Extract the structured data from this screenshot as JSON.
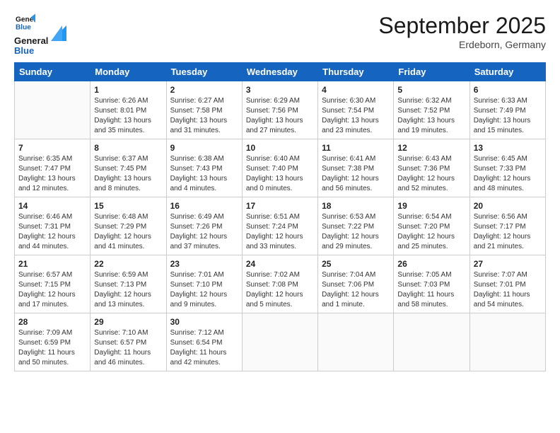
{
  "header": {
    "logo_line1": "General",
    "logo_line2": "Blue",
    "month_title": "September 2025",
    "subtitle": "Erdeborn, Germany"
  },
  "weekdays": [
    "Sunday",
    "Monday",
    "Tuesday",
    "Wednesday",
    "Thursday",
    "Friday",
    "Saturday"
  ],
  "weeks": [
    [
      {
        "day": "",
        "info": ""
      },
      {
        "day": "1",
        "info": "Sunrise: 6:26 AM\nSunset: 8:01 PM\nDaylight: 13 hours\nand 35 minutes."
      },
      {
        "day": "2",
        "info": "Sunrise: 6:27 AM\nSunset: 7:58 PM\nDaylight: 13 hours\nand 31 minutes."
      },
      {
        "day": "3",
        "info": "Sunrise: 6:29 AM\nSunset: 7:56 PM\nDaylight: 13 hours\nand 27 minutes."
      },
      {
        "day": "4",
        "info": "Sunrise: 6:30 AM\nSunset: 7:54 PM\nDaylight: 13 hours\nand 23 minutes."
      },
      {
        "day": "5",
        "info": "Sunrise: 6:32 AM\nSunset: 7:52 PM\nDaylight: 13 hours\nand 19 minutes."
      },
      {
        "day": "6",
        "info": "Sunrise: 6:33 AM\nSunset: 7:49 PM\nDaylight: 13 hours\nand 15 minutes."
      }
    ],
    [
      {
        "day": "7",
        "info": "Sunrise: 6:35 AM\nSunset: 7:47 PM\nDaylight: 13 hours\nand 12 minutes."
      },
      {
        "day": "8",
        "info": "Sunrise: 6:37 AM\nSunset: 7:45 PM\nDaylight: 13 hours\nand 8 minutes."
      },
      {
        "day": "9",
        "info": "Sunrise: 6:38 AM\nSunset: 7:43 PM\nDaylight: 13 hours\nand 4 minutes."
      },
      {
        "day": "10",
        "info": "Sunrise: 6:40 AM\nSunset: 7:40 PM\nDaylight: 13 hours\nand 0 minutes."
      },
      {
        "day": "11",
        "info": "Sunrise: 6:41 AM\nSunset: 7:38 PM\nDaylight: 12 hours\nand 56 minutes."
      },
      {
        "day": "12",
        "info": "Sunrise: 6:43 AM\nSunset: 7:36 PM\nDaylight: 12 hours\nand 52 minutes."
      },
      {
        "day": "13",
        "info": "Sunrise: 6:45 AM\nSunset: 7:33 PM\nDaylight: 12 hours\nand 48 minutes."
      }
    ],
    [
      {
        "day": "14",
        "info": "Sunrise: 6:46 AM\nSunset: 7:31 PM\nDaylight: 12 hours\nand 44 minutes."
      },
      {
        "day": "15",
        "info": "Sunrise: 6:48 AM\nSunset: 7:29 PM\nDaylight: 12 hours\nand 41 minutes."
      },
      {
        "day": "16",
        "info": "Sunrise: 6:49 AM\nSunset: 7:26 PM\nDaylight: 12 hours\nand 37 minutes."
      },
      {
        "day": "17",
        "info": "Sunrise: 6:51 AM\nSunset: 7:24 PM\nDaylight: 12 hours\nand 33 minutes."
      },
      {
        "day": "18",
        "info": "Sunrise: 6:53 AM\nSunset: 7:22 PM\nDaylight: 12 hours\nand 29 minutes."
      },
      {
        "day": "19",
        "info": "Sunrise: 6:54 AM\nSunset: 7:20 PM\nDaylight: 12 hours\nand 25 minutes."
      },
      {
        "day": "20",
        "info": "Sunrise: 6:56 AM\nSunset: 7:17 PM\nDaylight: 12 hours\nand 21 minutes."
      }
    ],
    [
      {
        "day": "21",
        "info": "Sunrise: 6:57 AM\nSunset: 7:15 PM\nDaylight: 12 hours\nand 17 minutes."
      },
      {
        "day": "22",
        "info": "Sunrise: 6:59 AM\nSunset: 7:13 PM\nDaylight: 12 hours\nand 13 minutes."
      },
      {
        "day": "23",
        "info": "Sunrise: 7:01 AM\nSunset: 7:10 PM\nDaylight: 12 hours\nand 9 minutes."
      },
      {
        "day": "24",
        "info": "Sunrise: 7:02 AM\nSunset: 7:08 PM\nDaylight: 12 hours\nand 5 minutes."
      },
      {
        "day": "25",
        "info": "Sunrise: 7:04 AM\nSunset: 7:06 PM\nDaylight: 12 hours\nand 1 minute."
      },
      {
        "day": "26",
        "info": "Sunrise: 7:05 AM\nSunset: 7:03 PM\nDaylight: 11 hours\nand 58 minutes."
      },
      {
        "day": "27",
        "info": "Sunrise: 7:07 AM\nSunset: 7:01 PM\nDaylight: 11 hours\nand 54 minutes."
      }
    ],
    [
      {
        "day": "28",
        "info": "Sunrise: 7:09 AM\nSunset: 6:59 PM\nDaylight: 11 hours\nand 50 minutes."
      },
      {
        "day": "29",
        "info": "Sunrise: 7:10 AM\nSunset: 6:57 PM\nDaylight: 11 hours\nand 46 minutes."
      },
      {
        "day": "30",
        "info": "Sunrise: 7:12 AM\nSunset: 6:54 PM\nDaylight: 11 hours\nand 42 minutes."
      },
      {
        "day": "",
        "info": ""
      },
      {
        "day": "",
        "info": ""
      },
      {
        "day": "",
        "info": ""
      },
      {
        "day": "",
        "info": ""
      }
    ]
  ]
}
